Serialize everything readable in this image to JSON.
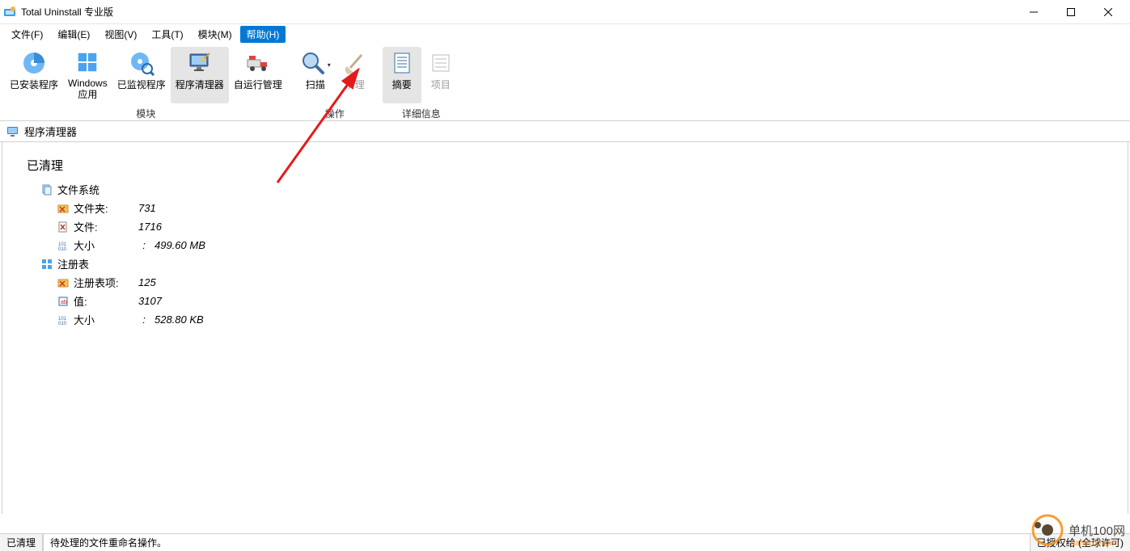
{
  "window": {
    "title": "Total Uninstall 专业版"
  },
  "menu": {
    "file": "文件(F)",
    "edit": "编辑(E)",
    "view": "视图(V)",
    "tools": "工具(T)",
    "modules": "模块(M)",
    "help": "帮助(H)"
  },
  "toolbar": {
    "installed": "已安装程序",
    "windows_apps_l1": "Windows",
    "windows_apps_l2": "应用",
    "monitored": "已监视程序",
    "cleaner": "程序清理器",
    "autorun": "自运行管理",
    "scan": "扫描",
    "clean": "清理",
    "summary": "摘要",
    "items": "项目",
    "grp_modules": "模块",
    "grp_ops": "操作",
    "grp_details": "详细信息"
  },
  "subheader": {
    "title": "程序清理器"
  },
  "results": {
    "heading": "已清理",
    "filesystem": {
      "label": "文件系统",
      "folders_label": "文件夹:",
      "folders_value": "731",
      "files_label": "文件:",
      "files_value": "1716",
      "size_label": "大小",
      "size_value": "499.60 MB"
    },
    "registry": {
      "label": "注册表",
      "keys_label": "注册表项:",
      "keys_value": "125",
      "values_label": "值:",
      "values_value": "3107",
      "size_label": "大小",
      "size_value": "528.80 KB"
    },
    "sep": ":"
  },
  "status": {
    "left": "已清理",
    "main": "待处理的文件重命名操作。",
    "right": "已授权给 (全球许可)"
  },
  "watermark": {
    "name": "单机100网",
    "url": "danji100.com"
  }
}
